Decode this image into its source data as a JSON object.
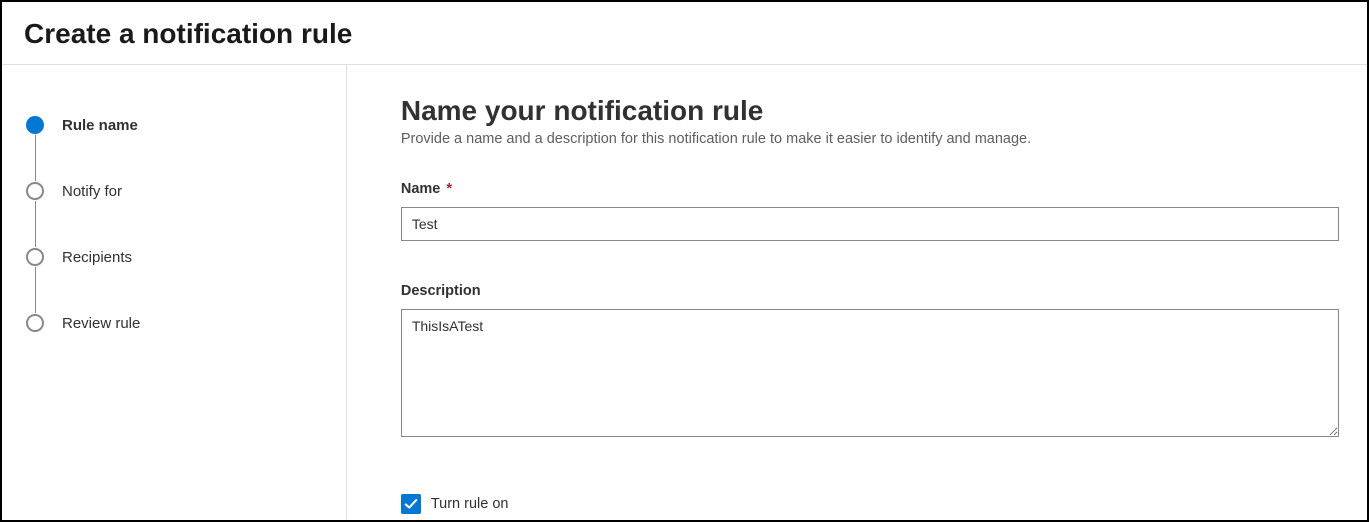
{
  "header": {
    "title": "Create a notification rule"
  },
  "stepper": {
    "steps": [
      {
        "label": "Rule name",
        "active": true
      },
      {
        "label": "Notify for",
        "active": false
      },
      {
        "label": "Recipients",
        "active": false
      },
      {
        "label": "Review rule",
        "active": false
      }
    ]
  },
  "main": {
    "heading": "Name your notification rule",
    "subtitle": "Provide a name and a description for this notification rule to make it easier to identify and manage.",
    "name_label": "Name",
    "name_required_mark": "*",
    "name_value": "Test",
    "description_label": "Description",
    "description_value": "ThisIsATest",
    "toggle": {
      "checked": true,
      "label": "Turn rule on"
    }
  },
  "colors": {
    "accent": "#0078d4",
    "required": "#a4262c",
    "border": "#8a8886"
  }
}
